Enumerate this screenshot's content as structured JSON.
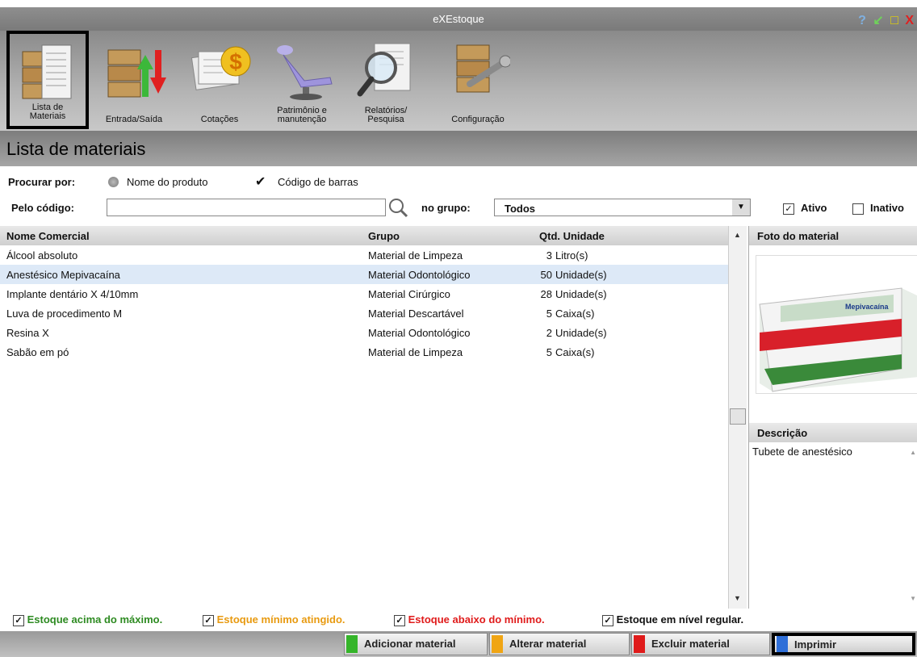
{
  "window": {
    "title": "eXEstoque",
    "controls": [
      "?",
      "↙",
      "□",
      "X"
    ]
  },
  "toolbar": [
    {
      "label1": "Lista de",
      "label2": "Materiais",
      "icon": "boxes-document-icon",
      "selected": true
    },
    {
      "label1": "",
      "label2": "Entrada/Saída",
      "icon": "boxes-arrows-icon",
      "selected": false
    },
    {
      "label1": "",
      "label2": "Cotações",
      "icon": "money-document-icon",
      "selected": false
    },
    {
      "label1": "Patrimônio e",
      "label2": "manutenção",
      "icon": "dental-chair-icon",
      "selected": false
    },
    {
      "label1": "Relatórios/",
      "label2": "Pesquisa",
      "icon": "magnifier-document-icon",
      "selected": false
    },
    {
      "label1": "",
      "label2": "Configuração",
      "icon": "boxes-wrench-icon",
      "selected": false
    }
  ],
  "page": {
    "title": "Lista de materiais"
  },
  "search": {
    "search_by_label": "Procurar por:",
    "option_name": "Nome do produto",
    "option_barcode": "Código de barras",
    "code_label": "Pelo código:",
    "code_value": "",
    "group_label": "no grupo:",
    "group_value": "Todos",
    "active_label": "Ativo",
    "inactive_label": "Inativo",
    "active_checked": true,
    "inactive_checked": false
  },
  "table": {
    "headers": {
      "name": "Nome Comercial",
      "group": "Grupo",
      "qty_unit": "Qtd. Unidade"
    },
    "rows": [
      {
        "name": "Álcool absoluto",
        "group": "Material de Limpeza",
        "qty": "3",
        "unit": "Litro(s)",
        "highlight": false
      },
      {
        "name": "Anestésico Mepivacaína",
        "group": "Material Odontológico",
        "qty": "50",
        "unit": "Unidade(s)",
        "highlight": true
      },
      {
        "name": "Implante dentário X 4/10mm",
        "group": "Material Cirúrgico",
        "qty": "28",
        "unit": "Unidade(s)",
        "highlight": false
      },
      {
        "name": "Luva de procedimento M",
        "group": "Material Descartável",
        "qty": "5",
        "unit": "Caixa(s)",
        "highlight": false
      },
      {
        "name": "Resina X",
        "group": "Material Odontológico",
        "qty": "2",
        "unit": "Unidade(s)",
        "highlight": false
      },
      {
        "name": "Sabão em pó",
        "group": "Material de Limpeza",
        "qty": "5",
        "unit": "Caixa(s)",
        "highlight": false
      }
    ]
  },
  "side": {
    "photo_label": "Foto do material",
    "photo_product_text": "Mepivacaína",
    "description_label": "Descrição",
    "description_text": "Tubete de anestésico"
  },
  "legend": [
    {
      "text": "Estoque acima do máximo.",
      "color": "#2e8b22"
    },
    {
      "text": "Estoque mínimo atingido.",
      "color": "#e89a10"
    },
    {
      "text": "Estoque abaixo do mínimo.",
      "color": "#e01b1b"
    },
    {
      "text": "Estoque em nível regular.",
      "color": "#111111"
    }
  ],
  "buttons": {
    "add": "Adicionar material",
    "edit": "Alterar material",
    "delete": "Excluir material",
    "print": "Imprimir"
  },
  "colors": {
    "add": "#35b52a",
    "edit": "#f0a514",
    "delete": "#e01b1b",
    "print": "#2f6fd8",
    "highlight_row": "#dde9f7"
  }
}
